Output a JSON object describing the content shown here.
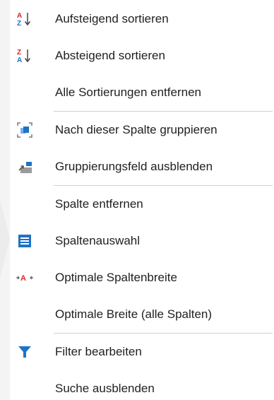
{
  "menu": {
    "sort_asc": "Aufsteigend sortieren",
    "sort_desc": "Absteigend sortieren",
    "clear_sorts": "Alle Sortierungen entfernen",
    "group_by_column": "Nach dieser Spalte gruppieren",
    "hide_group_panel": "Gruppierungsfeld ausblenden",
    "remove_column": "Spalte entfernen",
    "column_chooser": "Spaltenauswahl",
    "best_fit": "Optimale Spaltenbreite",
    "best_fit_all": "Optimale Breite (alle Spalten)",
    "filter_editor": "Filter bearbeiten",
    "hide_search": "Suche ausblenden"
  },
  "icons": {
    "sort_asc": "sort-ascending-icon",
    "sort_desc": "sort-descending-icon",
    "group": "group-by-column-icon",
    "hide_group": "hide-group-panel-icon",
    "column_chooser": "column-chooser-icon",
    "best_fit": "best-fit-icon",
    "filter": "filter-icon"
  },
  "colors": {
    "blue": "#1e73c8",
    "red": "#d9262c",
    "gray": "#7a7a7a",
    "text": "#1f1f1f",
    "separator": "#cfcfcf"
  }
}
